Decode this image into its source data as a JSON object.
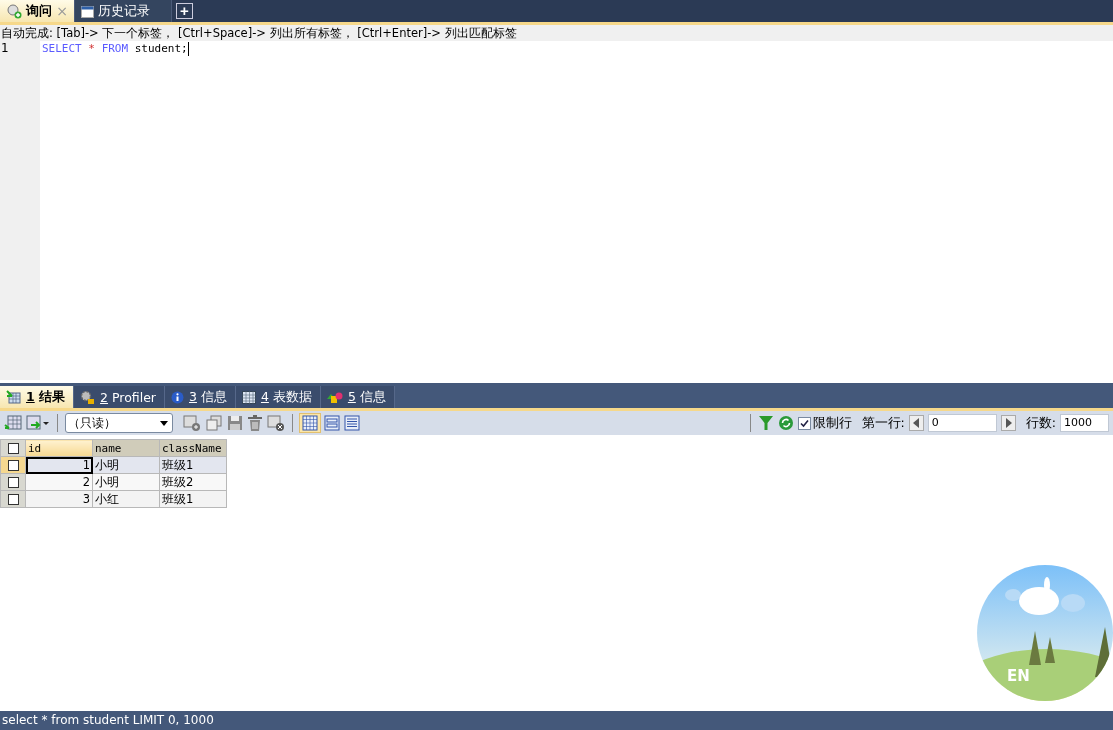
{
  "query_tabs": [
    {
      "label": "询问",
      "kind": "query",
      "close": "×",
      "selected": true
    },
    {
      "label": "历史记录",
      "kind": "calendar",
      "selected": false
    }
  ],
  "new_tab_button": "+",
  "autocomplete_hint": "自动完成: [Tab]-> 下一个标签， [Ctrl+Space]-> 列出所有标签， [Ctrl+Enter]-> 列出匹配标签",
  "editor": {
    "lines": [
      {
        "number": "1",
        "tokens": [
          {
            "text": "SELECT",
            "kind": "keyword"
          },
          {
            "text": " * ",
            "kind": "operator"
          },
          {
            "text": "FROM",
            "kind": "keyword"
          },
          {
            "text": " student;",
            "kind": "plain"
          }
        ]
      }
    ]
  },
  "result_tabs": [
    {
      "key": "1",
      "label": "结果",
      "kind": "grid",
      "selected": true
    },
    {
      "key": "2",
      "label": "Profiler",
      "kind": "profiler",
      "selected": false
    },
    {
      "key": "3",
      "label": "信息",
      "kind": "info",
      "selected": false
    },
    {
      "key": "4",
      "label": "表数据",
      "kind": "table",
      "selected": false
    },
    {
      "key": "5",
      "label": "信息",
      "kind": "shapes",
      "selected": false
    }
  ],
  "toolbar": {
    "mode_dropdown": "（只读）",
    "limit_rows": {
      "label": "限制行",
      "checked": true
    },
    "first_row": {
      "label": "第一行:",
      "value": "0"
    },
    "row_count": {
      "label": "行数:",
      "value": "1000"
    }
  },
  "table": {
    "select_all_checked": false,
    "columns": [
      "id",
      "name",
      "className"
    ],
    "rows": [
      {
        "cells": [
          "1",
          "小明",
          "班级1"
        ],
        "selected": true,
        "checked": false
      },
      {
        "cells": [
          "2",
          "小明",
          "班级2"
        ],
        "selected": false,
        "checked": false
      },
      {
        "cells": [
          "3",
          "小红",
          "班级1"
        ],
        "selected": false,
        "checked": false
      }
    ]
  },
  "status_bar": "select * from student LIMIT 0, 1000",
  "ime_widget": {
    "label": "EN"
  }
}
